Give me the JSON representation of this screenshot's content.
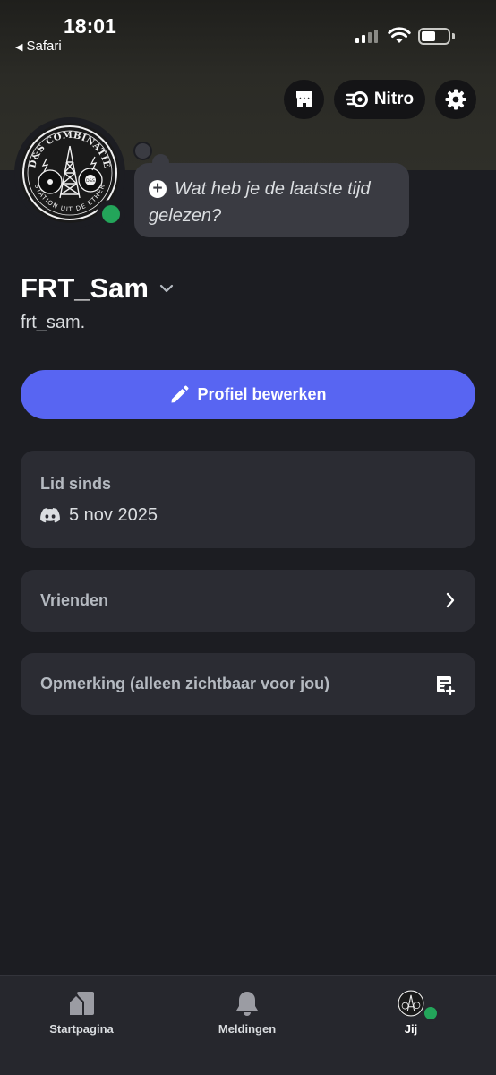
{
  "status_bar": {
    "time": "18:01",
    "back_app": "Safari"
  },
  "header": {
    "nitro_label": "Nitro"
  },
  "thought_bubble": {
    "placeholder": "Wat heb je de laatste tijd gelezen?"
  },
  "avatar": {
    "line1": "D&S COMBINATIE",
    "line2": "STATION UIT DE ETHER",
    "badge": "D&S"
  },
  "profile": {
    "display_name": "FRT_Sam",
    "username": "frt_sam."
  },
  "actions": {
    "edit_profile_label": "Profiel bewerken"
  },
  "member_card": {
    "label": "Lid sinds",
    "date": "5 nov 2025"
  },
  "friends_card": {
    "label": "Vrienden"
  },
  "note_card": {
    "label": "Opmerking (alleen zichtbaar voor jou)"
  },
  "bottom_nav": {
    "items": [
      {
        "label": "Startpagina"
      },
      {
        "label": "Meldingen"
      },
      {
        "label": "Jij"
      }
    ]
  },
  "colors": {
    "accent": "#5865f2",
    "online": "#23a55a",
    "background": "#1c1d22",
    "card": "#2b2c33"
  },
  "icons": [
    "shop-icon",
    "nitro-icon",
    "gear-icon",
    "plus-icon",
    "chevron-down-icon",
    "pencil-icon",
    "discord-icon",
    "chevron-right-icon",
    "note-add-icon",
    "home-icon",
    "bell-icon"
  ]
}
